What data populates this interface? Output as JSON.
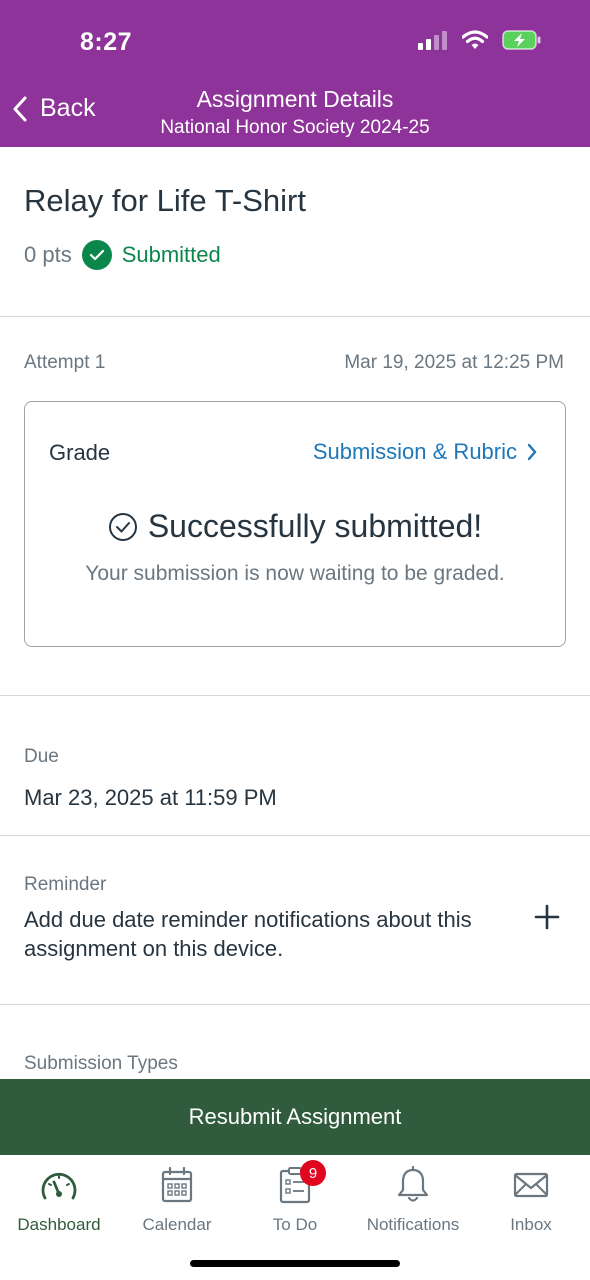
{
  "status_bar": {
    "time": "8:27"
  },
  "nav": {
    "back_label": "Back",
    "title": "Assignment Details",
    "subtitle": "National Honor Society 2024-25"
  },
  "assignment": {
    "title": "Relay for Life T-Shirt",
    "points": "0 pts",
    "status": "Submitted"
  },
  "attempt": {
    "label": "Attempt 1",
    "date": "Mar 19, 2025 at 12:25 PM"
  },
  "grade_card": {
    "label": "Grade",
    "link_label": "Submission & Rubric",
    "success_title": "Successfully submitted!",
    "success_subtitle": "Your submission is now waiting to be graded."
  },
  "due": {
    "label": "Due",
    "value": "Mar 23, 2025 at 11:59 PM"
  },
  "reminder": {
    "label": "Reminder",
    "text": "Add due date reminder notifications about this assignment on this device."
  },
  "submission_types": {
    "label": "Submission Types"
  },
  "resubmit_label": "Resubmit Assignment",
  "tabs": [
    {
      "label": "Dashboard",
      "icon": "dashboard-icon"
    },
    {
      "label": "Calendar",
      "icon": "calendar-icon"
    },
    {
      "label": "To Do",
      "icon": "todo-icon",
      "badge": "9"
    },
    {
      "label": "Notifications",
      "icon": "bell-icon"
    },
    {
      "label": "Inbox",
      "icon": "mail-icon"
    }
  ],
  "colors": {
    "header": "#8e3399",
    "success": "#0b874b",
    "link": "#1d77b9",
    "primary_button": "#305b3c",
    "badge": "#e0061f"
  }
}
